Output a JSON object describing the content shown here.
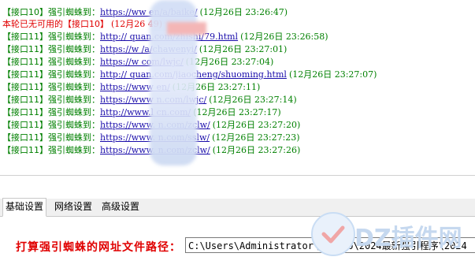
{
  "log": {
    "lines": [
      {
        "tag": "【接口10】",
        "prefix": "强引蜘蛛到：",
        "url": "https://ww                en/a/baike/",
        "time": "(12月26日 23:26:47)",
        "warn": false
      },
      {
        "tag": "本轮已无可用的【接口10】",
        "prefix": "",
        "url": "",
        "time": "(12月26                49)",
        "warn": true
      },
      {
        "tag": "【接口11】",
        "prefix": "强引蜘蛛到：",
        "url": "http://          quan.com/zhishi/79.html",
        "time": "(12月26日 23:26:58)",
        "warn": false
      },
      {
        "tag": "【接口11】",
        "prefix": "强引蜘蛛到：",
        "url": "https://w               /a/chawenyi/",
        "time": "(12月26日 23:27:01)",
        "warn": false
      },
      {
        "tag": "【接口11】",
        "prefix": "强引蜘蛛到：",
        "url": "https://w              com/lwjc/",
        "time": "(12月26日 23:27:04)",
        "warn": false
      },
      {
        "tag": "【接口11】",
        "prefix": "强引蜘蛛到：",
        "url": "http://          quan.com/jiaocheng/shuoming.html",
        "time": "(12月26日 23:27:07)",
        "warn": false
      },
      {
        "tag": "【接口11】",
        "prefix": "强引蜘蛛到：",
        "url": "https://www              en/",
        "time": "(12月26日 23:27:11)",
        "warn": false
      },
      {
        "tag": "【接口11】",
        "prefix": "强引蜘蛛到：",
        "url": "https://www            n.com/lwjc/",
        "time": "(12月26日 23:27:14)",
        "warn": false
      },
      {
        "tag": "【接口11】",
        "prefix": "强引蜘蛛到：",
        "url": "http://www.l           cn.com/",
        "time": "(12月26日 23:27:17)",
        "warn": false
      },
      {
        "tag": "【接口11】",
        "prefix": "强引蜘蛛到：",
        "url": "https://www.           n.com/zclw/",
        "time": "(12月26日 23:27:20)",
        "warn": false
      },
      {
        "tag": "【接口11】",
        "prefix": "强引蜘蛛到：",
        "url": "https://www.           n.com/sslw/",
        "time": "(12月26日 23:27:23)",
        "warn": false
      },
      {
        "tag": "【接口11】",
        "prefix": "强引蜘蛛到：",
        "url": "https://www.           n.com/zclw/",
        "time": "(12月26日 23:27:26)",
        "warn": false
      }
    ]
  },
  "tabs": [
    {
      "label": "基础设置"
    },
    {
      "label": "网络设置"
    },
    {
      "label": "高级设置"
    }
  ],
  "settings": {
    "path_label": "打算强引蜘蛛的网址文件路径：",
    "path_value": "C:\\Users\\Administrator\\Deskto\\2024最新强引程序\\2024"
  },
  "watermark": {
    "text": "DZ插件网"
  },
  "colors": {
    "log_green": "#008000",
    "log_red": "#e00000",
    "link_blue": "#1a0dab"
  }
}
